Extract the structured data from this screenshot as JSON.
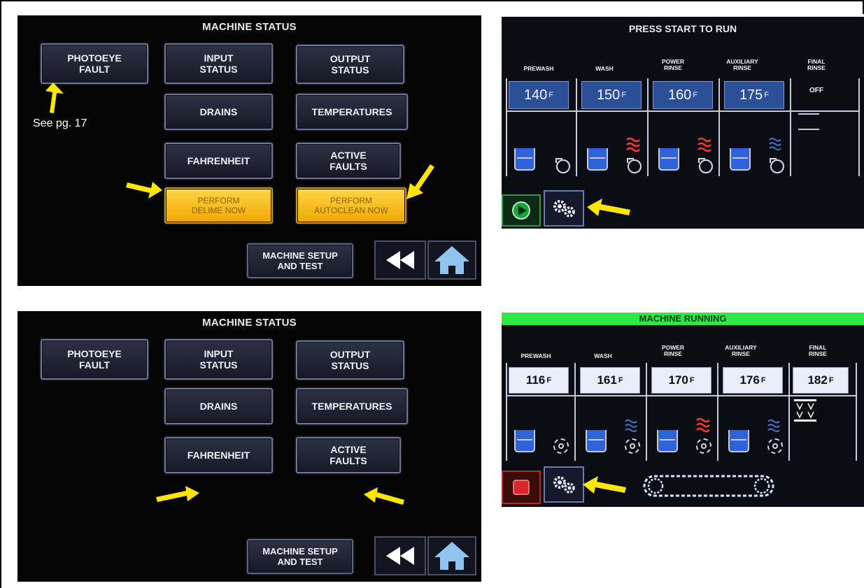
{
  "status_panel_1": {
    "title": "MACHINE STATUS",
    "photoeye": "PHOTOEYE\nFAULT",
    "input": "INPUT\nSTATUS",
    "output": "OUTPUT\nSTATUS",
    "drains": "DRAINS",
    "temperatures": "TEMPERATURES",
    "fahrenheit": "FAHRENHEIT",
    "active_faults": "ACTIVE\nFAULTS",
    "delime": "PERFORM\nDELIME NOW",
    "autoclean": "PERFORM\nAUTOCLEAN NOW",
    "setup": "MACHINE SETUP\nAND TEST",
    "note": "See pg. 17"
  },
  "status_panel_2": {
    "title": "MACHINE STATUS",
    "photoeye": "PHOTOEYE\nFAULT",
    "input": "INPUT\nSTATUS",
    "output": "OUTPUT\nSTATUS",
    "drains": "DRAINS",
    "temperatures": "TEMPERATURES",
    "fahrenheit": "FAHRENHEIT",
    "active_faults": "ACTIVE\nFAULTS",
    "setup": "MACHINE SETUP\nAND TEST"
  },
  "run_panel": {
    "title": "PRESS START TO RUN",
    "labels": [
      "PREWASH",
      "WASH",
      "POWER\nRINSE",
      "AUXILIARY\nRINSE",
      "FINAL\nRINSE"
    ],
    "temps": [
      "140",
      "150",
      "160",
      "175"
    ],
    "unit": "F",
    "final": "OFF"
  },
  "running_panel": {
    "title": "MACHINE RUNNING",
    "labels": [
      "PREWASH",
      "WASH",
      "POWER\nRINSE",
      "AUXILIARY\nRINSE",
      "FINAL\nRINSE"
    ],
    "temps": [
      "116",
      "161",
      "170",
      "176",
      "182"
    ],
    "unit": "F"
  },
  "colors": {
    "accent_yellow": "#ffe600",
    "running_green": "#2ee84a",
    "heat_red": "#ff3b30",
    "tank_blue": "#2f62d8"
  },
  "icons": {
    "back": "double-left-arrow-icon",
    "home": "home-icon",
    "start": "play-icon",
    "settings": "gears-icon",
    "stop": "stop-icon",
    "conveyor": "conveyor-icon"
  }
}
